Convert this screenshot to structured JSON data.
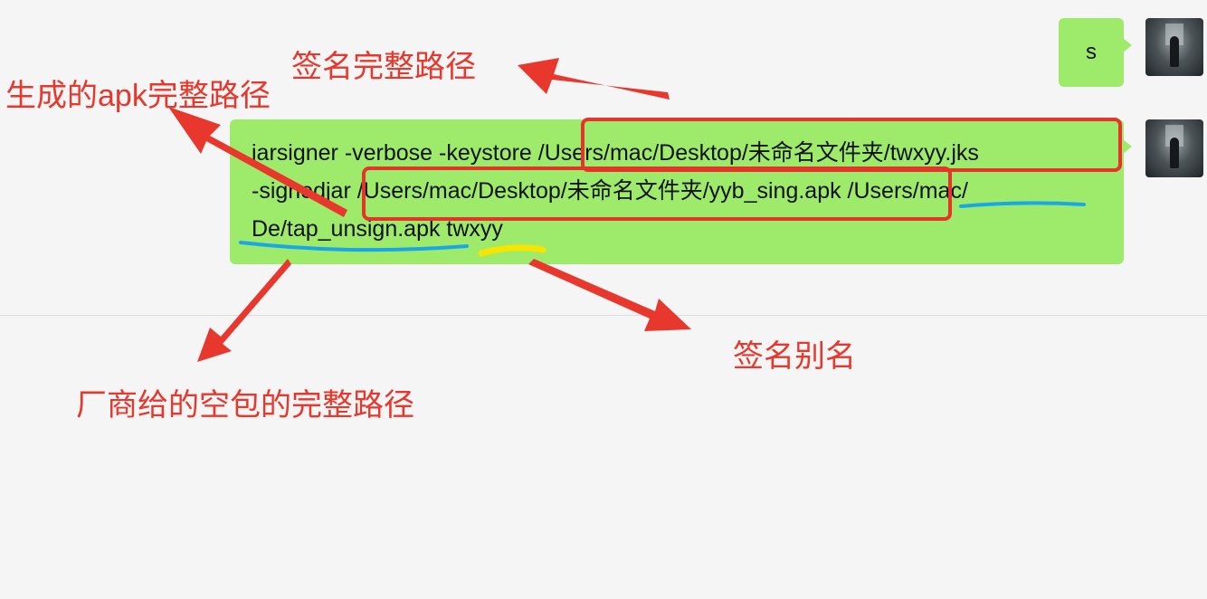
{
  "chat": {
    "message_1": "s",
    "message_2": {
      "line_1_visible_prefix": "",
      "line_1": "jarsigner -verbose -keystore  /Users/mac/Desktop/未命名文件夹/twxyy.jks",
      "line_2": "-signedjar /Users/mac/Desktop/未命名文件夹/yyb_sing.apk  /Users/mac/",
      "line_3": "De/tap_unsign.apk twxyy"
    }
  },
  "annotations": {
    "keystore_path": "签名完整路径",
    "output_apk_path": "生成的apk完整路径",
    "unsigned_apk_path": "厂商给的空包的完整路径",
    "alias": "签名别名"
  },
  "colors": {
    "bubble": "#9eea6a",
    "annotation_red": "#e8372c",
    "underline_blue": "#1aa7e8",
    "underline_yellow": "#f5e500",
    "background": "#f5f5f5"
  },
  "icons": {
    "avatar": "user-avatar-icon"
  }
}
